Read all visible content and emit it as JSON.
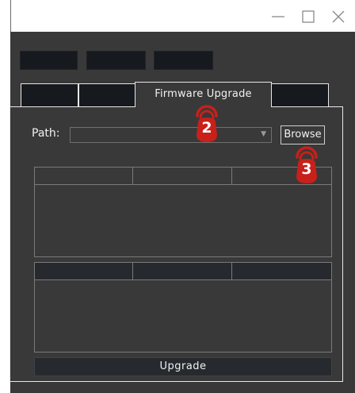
{
  "window": {
    "controls": [
      "minimize",
      "maximize",
      "close"
    ]
  },
  "tabs": {
    "active_label": "Firmware Upgrade"
  },
  "path": {
    "label": "Path:",
    "value": ""
  },
  "browse_label": "Browse",
  "upgrade_label": "Upgrade",
  "annotations": [
    {
      "number": "2",
      "color": "#c8201a"
    },
    {
      "number": "3",
      "color": "#c8201a"
    }
  ],
  "colors": {
    "background": "#393939",
    "dark_button": "#16191d",
    "border": "#e8e8e8",
    "marker": "#c8201a"
  }
}
